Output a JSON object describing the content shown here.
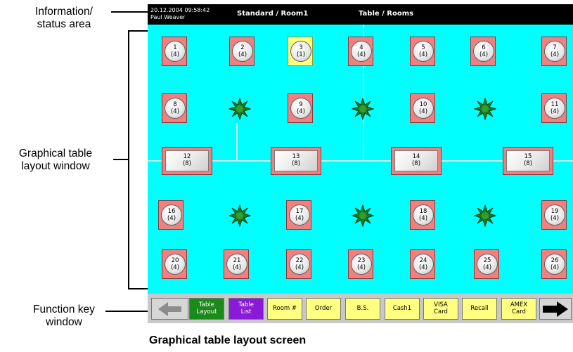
{
  "annotations": {
    "status_area": "Information/\nstatus area",
    "layout_window": "Graphical table\nlayout window",
    "function_window": "Function key\nwindow",
    "caption": "Graphical table layout screen"
  },
  "status": {
    "datetime": "20.12.2004 09:58:42",
    "user": "Paul Weaver",
    "layout": "Standard / Room1",
    "view": "Table / Rooms"
  },
  "tables": [
    {
      "label": "1\n(4)",
      "selected": false
    },
    {
      "label": "2\n(4)",
      "selected": false
    },
    {
      "label": "3\n(1)",
      "selected": true
    },
    {
      "label": "4\n(4)",
      "selected": false
    },
    {
      "label": "5\n(4)",
      "selected": false
    },
    {
      "label": "6\n(4)",
      "selected": false
    },
    {
      "label": "7\n(4)",
      "selected": false
    },
    {
      "label": "8\n(4)",
      "selected": false
    },
    {
      "label": "9\n(4)",
      "selected": false
    },
    {
      "label": "10\n(4)",
      "selected": false
    },
    {
      "label": "11\n(4)",
      "selected": false
    },
    {
      "label": "12\n(8)",
      "selected": false
    },
    {
      "label": "13\n(8)",
      "selected": false
    },
    {
      "label": "14\n(8)",
      "selected": false
    },
    {
      "label": "15\n(8)",
      "selected": false
    },
    {
      "label": "16\n(4)",
      "selected": false
    },
    {
      "label": "17\n(4)",
      "selected": false
    },
    {
      "label": "18\n(4)",
      "selected": false
    },
    {
      "label": "19\n(4)",
      "selected": false
    },
    {
      "label": "20\n(4)",
      "selected": false
    },
    {
      "label": "21\n(4)",
      "selected": false
    },
    {
      "label": "22\n(4)",
      "selected": false
    },
    {
      "label": "23\n(4)",
      "selected": false
    },
    {
      "label": "24\n(4)",
      "selected": false
    },
    {
      "label": "25\n(4)",
      "selected": false
    },
    {
      "label": "26\n(4)",
      "selected": false
    }
  ],
  "function_keys": [
    {
      "icon": "arrow-left-icon",
      "label": ""
    },
    {
      "label": "Table\nLayout",
      "color": "#1a8a1a"
    },
    {
      "label": "Table\nList",
      "color": "#8a1ad8"
    },
    {
      "label": "Room #",
      "color": "#ffff80"
    },
    {
      "label": "Order",
      "color": "#ffff80"
    },
    {
      "label": "B.S.",
      "color": "#ffff80"
    },
    {
      "label": "Cash1",
      "color": "#ffff80"
    },
    {
      "label": "VISA\nCard",
      "color": "#ffff80"
    },
    {
      "label": "Recall",
      "color": "#ffff80"
    },
    {
      "label": "AMEX\nCard",
      "color": "#ffff80"
    },
    {
      "icon": "arrow-right-icon",
      "label": ""
    }
  ],
  "colors": {
    "floor": "#00ffff",
    "table": "#f08080",
    "selected_table": "#ffff80",
    "status_bar": "#000000"
  }
}
